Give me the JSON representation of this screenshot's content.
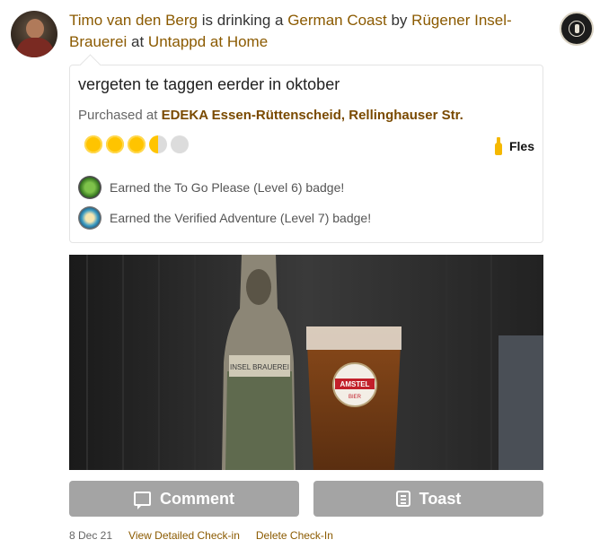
{
  "checkin": {
    "user": "Timo van den Berg",
    "text_drinking": "is drinking a",
    "beer": "German Coast",
    "text_by": "by",
    "brewery": "Rügener Insel-Brauerei",
    "text_at": "at",
    "venue": "Untappd at Home"
  },
  "card": {
    "comment": "vergeten te taggen eerder in oktober",
    "purchased_prefix": "Purchased at",
    "purchased_store": "EDEKA Essen-Rüttenscheid",
    "purchased_separator": ",",
    "purchased_street": "Rellinghauser Str.",
    "rating": 3.5,
    "rating_max": 5,
    "serving_icon": "bottle-icon",
    "serving_label": "Fles",
    "badges": [
      {
        "icon": "to-go-please-badge-icon",
        "text": "Earned the To Go Please (Level 6) badge!"
      },
      {
        "icon": "verified-adventure-badge-icon",
        "text": "Earned the Verified Adventure (Level 7) badge!"
      }
    ]
  },
  "photo": {
    "bottle_label": "INSEL BRAUEREI",
    "glass_logo": "AMSTEL",
    "glass_logo_sub": "BIER"
  },
  "actions": {
    "comment_label": "Comment",
    "toast_label": "Toast"
  },
  "footer": {
    "date": "8 Dec 21",
    "view_detail": "View Detailed Check-in",
    "delete": "Delete Check-In"
  },
  "colors": {
    "link": "#8b5a00",
    "button": "#a4a4a4",
    "rating": "#ffc400"
  }
}
